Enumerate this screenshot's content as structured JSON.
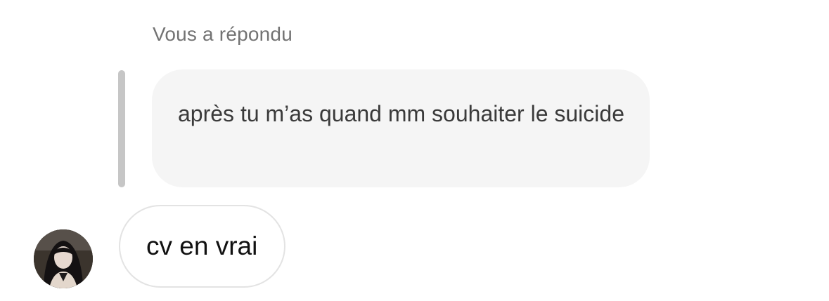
{
  "reply": {
    "label": "Vous a répondu",
    "quoted_text": "après tu m’as quand mm souhaiter le suicide"
  },
  "message": {
    "text": "cv en vrai"
  },
  "avatar": {
    "icon": "profile-photo"
  },
  "colors": {
    "quote_bar": "#c6c6c6",
    "quoted_bubble_bg": "#f5f5f5",
    "message_border": "#e3e3e3",
    "label_text": "#737373"
  }
}
